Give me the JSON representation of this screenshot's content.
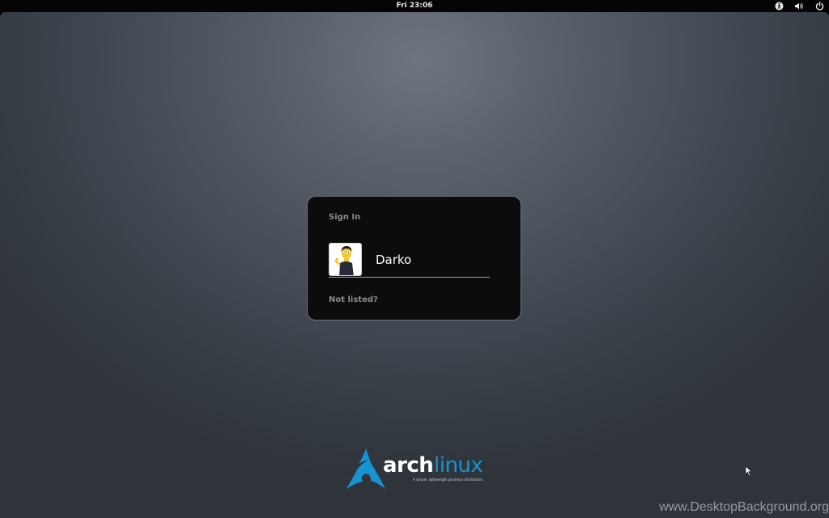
{
  "topbar": {
    "clock": "Fri 23:06",
    "tray": [
      {
        "icon": "accessibility-icon"
      },
      {
        "icon": "volume-icon"
      },
      {
        "icon": "power-icon"
      }
    ]
  },
  "login": {
    "title": "Sign In",
    "users": [
      {
        "name": "Darko",
        "avatar": "user-avatar"
      }
    ],
    "not_listed": "Not listed?"
  },
  "branding": {
    "logo_arch": "arch",
    "logo_linux": "linux",
    "logo_tagline": "A simple, lightweight gnu/linux distribution.",
    "accent_color": "#1793d1"
  },
  "watermark": "www.DesktopBackground.org"
}
